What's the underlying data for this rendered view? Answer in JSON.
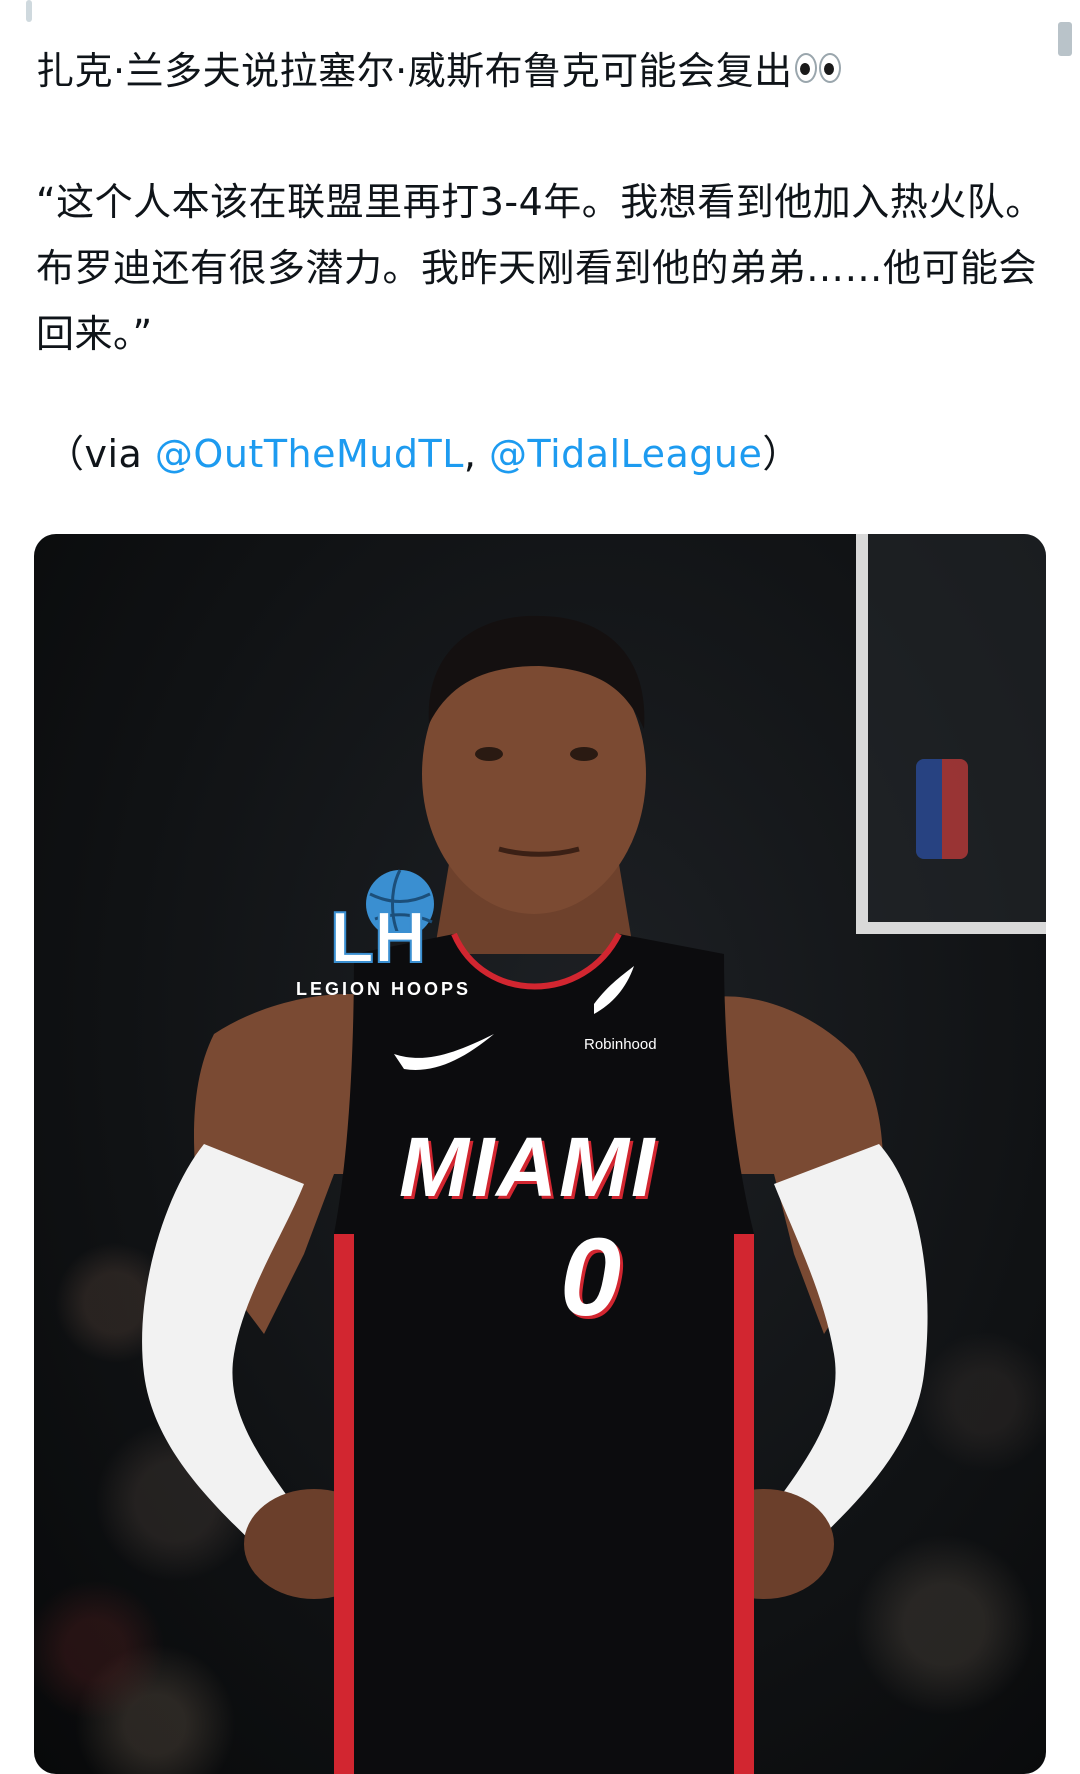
{
  "post": {
    "title": "扎克·兰多夫说拉塞尔·威斯布鲁克可能会复出",
    "title_emoji": "eyes-icon",
    "quote": "“这个人本该在联盟里再打3-4年。我想看到他加入热火队。布罗迪还有很多潜力。我昨天刚看到他的弟弟……他可能会回来。”",
    "via_open": "（via ",
    "via_link1": "@OutTheMudTL",
    "via_sep": ", ",
    "via_link2": "@TidalLeague",
    "via_close": "）"
  },
  "media": {
    "logo_text": "LEGION HOOPS",
    "logo_letters": "LH",
    "sponsor": "Robinhood",
    "jersey_team": "MIAMI",
    "jersey_number": "0"
  },
  "colors": {
    "link": "#1d9bf0",
    "text": "#0f1419",
    "jersey_red": "#d22630",
    "logo_blue": "#3a8fd1"
  }
}
